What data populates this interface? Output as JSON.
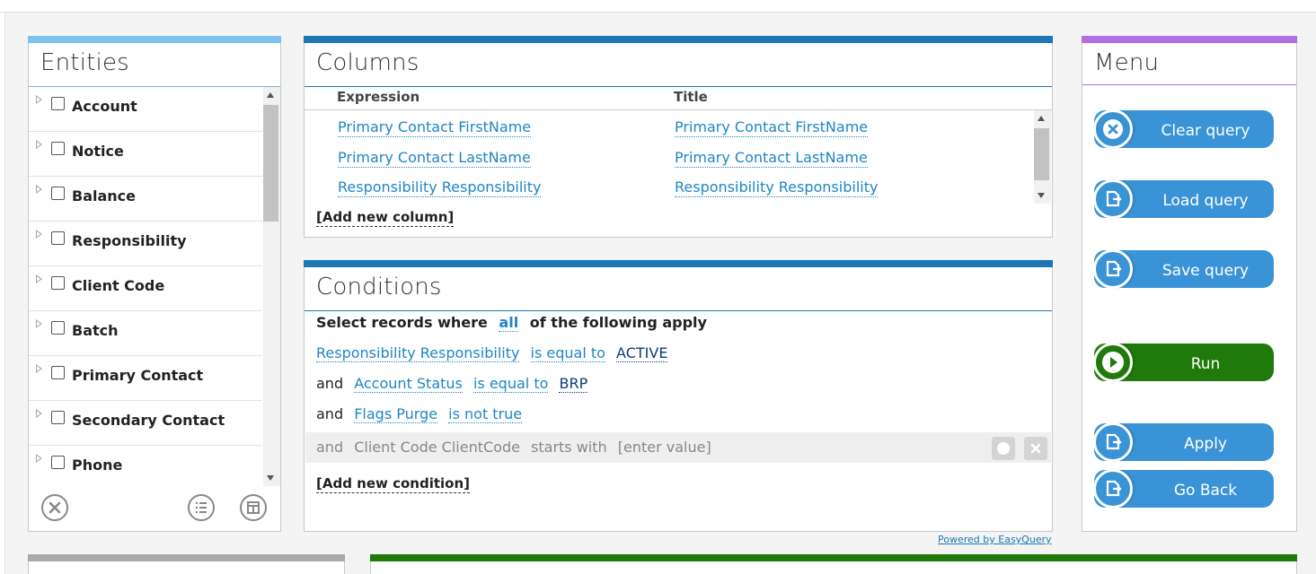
{
  "entities": {
    "title": "Entities",
    "items": [
      {
        "label": "Account"
      },
      {
        "label": "Notice"
      },
      {
        "label": "Balance"
      },
      {
        "label": "Responsibility"
      },
      {
        "label": "Client Code"
      },
      {
        "label": "Batch"
      },
      {
        "label": "Primary Contact"
      },
      {
        "label": "Secondary Contact"
      },
      {
        "label": "Phone"
      }
    ],
    "footer_icons": [
      "clear-selection-icon",
      "list-icon",
      "table-icon"
    ]
  },
  "columns": {
    "title": "Columns",
    "headers": {
      "expression": "Expression",
      "title": "Title"
    },
    "rows": [
      {
        "expression": "Primary Contact FirstName",
        "title": "Primary Contact FirstName"
      },
      {
        "expression": "Primary Contact LastName",
        "title": "Primary Contact LastName"
      },
      {
        "expression": "Responsibility Responsibility",
        "title": "Responsibility Responsibility"
      }
    ],
    "add_label": "[Add new column]"
  },
  "conditions": {
    "title": "Conditions",
    "header": {
      "prefix": "Select records where",
      "link": "all",
      "suffix": "of the following apply"
    },
    "rows": [
      {
        "conj": "",
        "field": "Responsibility Responsibility",
        "op": "is equal to",
        "value": "ACTIVE"
      },
      {
        "conj": "and",
        "field": "Account Status",
        "op": "is equal to",
        "value": "BRP"
      },
      {
        "conj": "and",
        "field": "Flags Purge",
        "op": "is not true",
        "value": ""
      }
    ],
    "pending": {
      "conj": "and",
      "field": "Client Code ClientCode",
      "op": "starts with",
      "value": "[enter value]"
    },
    "add_label": "[Add new condition]"
  },
  "powered_by": "Powered by EasyQuery",
  "menu": {
    "title": "Menu",
    "buttons": [
      {
        "label": "Clear query",
        "icon": "clear-icon"
      },
      {
        "label": "Load query",
        "icon": "load-icon"
      },
      {
        "label": "Save query",
        "icon": "save-icon"
      },
      {
        "label": "Run",
        "icon": "play-icon"
      },
      {
        "label": "Apply",
        "icon": "apply-icon"
      },
      {
        "label": "Go Back",
        "icon": "go-back-icon"
      }
    ]
  },
  "colors": {
    "entities_accent": "#7cc4f0",
    "columns_accent": "#1b78b4",
    "menu_accent": "#b36ee6",
    "button_blue": "#3a93d6",
    "button_green": "#1f7a0a",
    "link": "#1f86c6"
  }
}
